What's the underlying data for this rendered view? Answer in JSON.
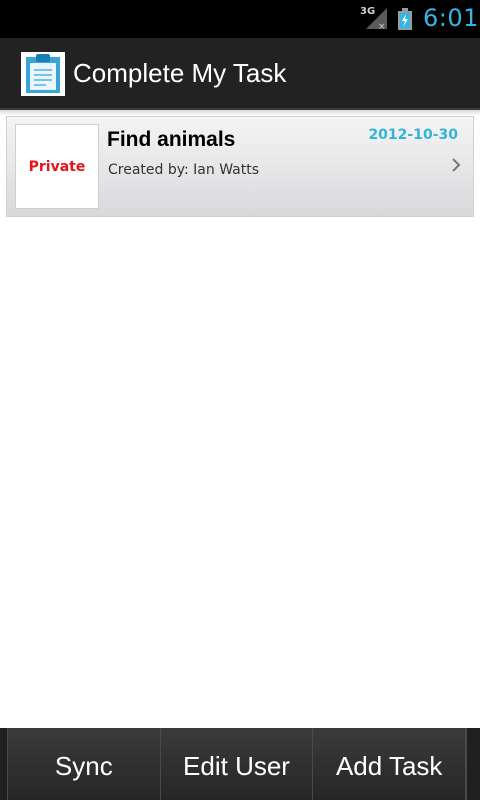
{
  "status_bar": {
    "network_label": "3G",
    "network_icon": "signal-icon",
    "battery_icon": "battery-charging-icon",
    "time": "6:01",
    "time_color": "#33b5e5"
  },
  "action_bar": {
    "app_icon": "clipboard-icon",
    "title": "Complete My Task"
  },
  "tasks": [
    {
      "privacy": "Private",
      "privacy_color": "#e8121a",
      "title": "Find animals",
      "created_by": "Created by: Ian Watts",
      "date": "2012-10-30",
      "date_color": "#33b5d6",
      "chevron_icon": "chevron-right-icon"
    }
  ],
  "bottom_bar": {
    "sync_label": "Sync",
    "edit_user_label": "Edit User",
    "add_task_label": "Add Task"
  }
}
